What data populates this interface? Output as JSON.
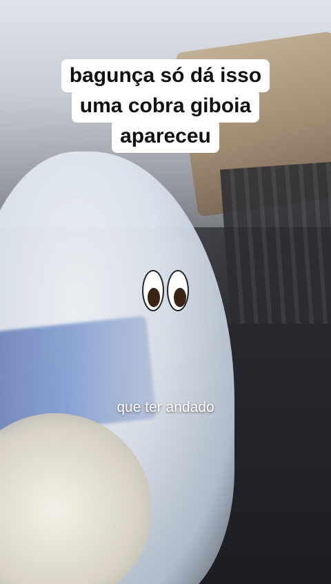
{
  "overlay": {
    "caption_lines": [
      "bagunça só dá isso",
      "uma cobra giboia",
      "apareceu"
    ],
    "emoji": "eyes-emoji",
    "subtitle": "que ter andado"
  }
}
